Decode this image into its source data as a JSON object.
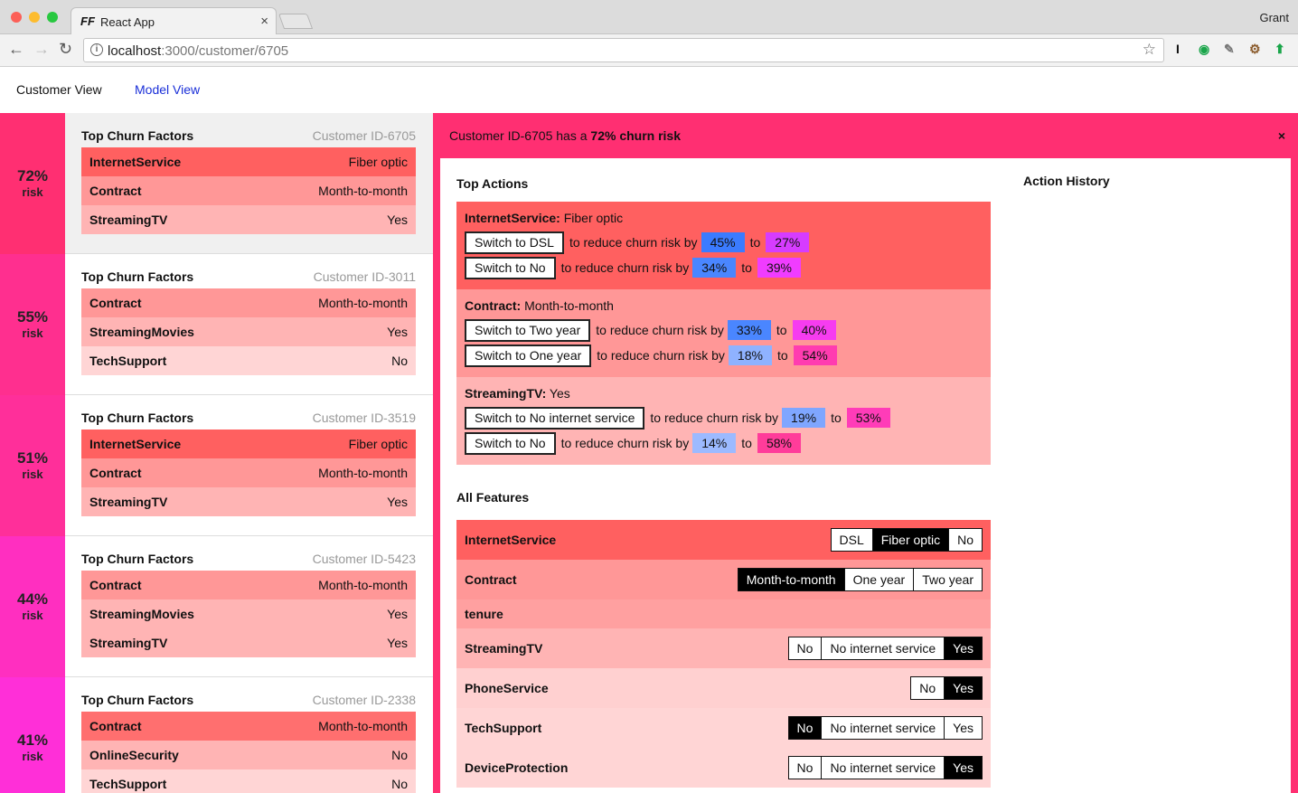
{
  "browser": {
    "tab_title": "React App",
    "tab_icon": "FF",
    "tab_close": "×",
    "profile": "Grant",
    "url_host": "localhost",
    "url_rest": ":3000/customer/6705",
    "extensions": [
      "I",
      "◉",
      "✎",
      "⚙",
      "⬆"
    ]
  },
  "nav": {
    "customer_view": "Customer View",
    "model_view": "Model View"
  },
  "cards": [
    {
      "pct": "72%",
      "risk": "risk",
      "title": "Top Churn Factors",
      "id": "Customer ID-6705",
      "color": "#ff2f72",
      "factors": [
        {
          "name": "InternetService",
          "value": "Fiber optic",
          "color": "#ff6060"
        },
        {
          "name": "Contract",
          "value": "Month-to-month",
          "color": "#ff9797"
        },
        {
          "name": "StreamingTV",
          "value": "Yes",
          "color": "#ffb4b4"
        }
      ]
    },
    {
      "pct": "55%",
      "risk": "risk",
      "title": "Top Churn Factors",
      "id": "Customer ID-3011",
      "color": "#ff2f8f",
      "factors": [
        {
          "name": "Contract",
          "value": "Month-to-month",
          "color": "#ff9797"
        },
        {
          "name": "StreamingMovies",
          "value": "Yes",
          "color": "#ffb4b4"
        },
        {
          "name": "TechSupport",
          "value": "No",
          "color": "#ffd5d5"
        }
      ]
    },
    {
      "pct": "51%",
      "risk": "risk",
      "title": "Top Churn Factors",
      "id": "Customer ID-3519",
      "color": "#ff2f9a",
      "factors": [
        {
          "name": "InternetService",
          "value": "Fiber optic",
          "color": "#ff6060"
        },
        {
          "name": "Contract",
          "value": "Month-to-month",
          "color": "#ff9797"
        },
        {
          "name": "StreamingTV",
          "value": "Yes",
          "color": "#ffb4b4"
        }
      ]
    },
    {
      "pct": "44%",
      "risk": "risk",
      "title": "Top Churn Factors",
      "id": "Customer ID-5423",
      "color": "#ff2fc0",
      "factors": [
        {
          "name": "Contract",
          "value": "Month-to-month",
          "color": "#ff9797"
        },
        {
          "name": "StreamingMovies",
          "value": "Yes",
          "color": "#ffb4b4"
        },
        {
          "name": "StreamingTV",
          "value": "Yes",
          "color": "#ffb4b4"
        }
      ]
    },
    {
      "pct": "41%",
      "risk": "risk",
      "title": "Top Churn Factors",
      "id": "Customer ID-2338",
      "color": "#ff2fd8",
      "factors": [
        {
          "name": "Contract",
          "value": "Month-to-month",
          "color": "#ff6f6f"
        },
        {
          "name": "OnlineSecurity",
          "value": "No",
          "color": "#ffb4b4"
        },
        {
          "name": "TechSupport",
          "value": "No",
          "color": "#ffd5d5"
        }
      ]
    }
  ],
  "detail": {
    "header_prefix": "Customer ID-6705 has a ",
    "header_bold": "72% churn risk",
    "close": "×",
    "top_actions_title": "Top Actions",
    "action_history_title": "Action History",
    "all_features_title": "All Features",
    "reduce_text": "to reduce churn risk by",
    "to_text": "to",
    "action_groups": [
      {
        "feature": "InternetService:",
        "value": "Fiber optic",
        "color": "#ff6060",
        "actions": [
          {
            "button": "Switch to DSL",
            "by": "45%",
            "to": "27%",
            "by_color": "#3b7bff",
            "to_color": "#d63cff"
          },
          {
            "button": "Switch to No",
            "by": "34%",
            "to": "39%",
            "by_color": "#4a86ff",
            "to_color": "#f03cff"
          }
        ]
      },
      {
        "feature": "Contract:",
        "value": "Month-to-month",
        "color": "#ff9797",
        "actions": [
          {
            "button": "Switch to Two year",
            "by": "33%",
            "to": "40%",
            "by_color": "#4a86ff",
            "to_color": "#f63cf0"
          },
          {
            "button": "Switch to One year",
            "by": "18%",
            "to": "54%",
            "by_color": "#8fb2ff",
            "to_color": "#ff3cb0"
          }
        ]
      },
      {
        "feature": "StreamingTV:",
        "value": "Yes",
        "color": "#ffb4b4",
        "actions": [
          {
            "button": "Switch to No internet service",
            "by": "19%",
            "to": "53%",
            "by_color": "#7fa6ff",
            "to_color": "#ff3cb8"
          },
          {
            "button": "Switch to No",
            "by": "14%",
            "to": "58%",
            "by_color": "#9cbaff",
            "to_color": "#ff3c9a"
          }
        ]
      }
    ],
    "features": [
      {
        "name": "InternetService",
        "color": "#ff6060",
        "options": [
          "DSL",
          "Fiber optic",
          "No"
        ],
        "selected": 1
      },
      {
        "name": "Contract",
        "color": "#ff9797",
        "options": [
          "Month-to-month",
          "One year",
          "Two year"
        ],
        "selected": 0
      },
      {
        "name": "tenure",
        "color": "#ffa0a0",
        "options": [],
        "selected": -1
      },
      {
        "name": "StreamingTV",
        "color": "#ffb4b4",
        "options": [
          "No",
          "No internet service",
          "Yes"
        ],
        "selected": 2
      },
      {
        "name": "PhoneService",
        "color": "#ffd0d0",
        "options": [
          "No",
          "Yes"
        ],
        "selected": 1
      },
      {
        "name": "TechSupport",
        "color": "#ffd5d5",
        "options": [
          "No",
          "No internet service",
          "Yes"
        ],
        "selected": 0
      },
      {
        "name": "DeviceProtection",
        "color": "#ffd5d5",
        "options": [
          "No",
          "No internet service",
          "Yes"
        ],
        "selected": 2
      }
    ]
  }
}
